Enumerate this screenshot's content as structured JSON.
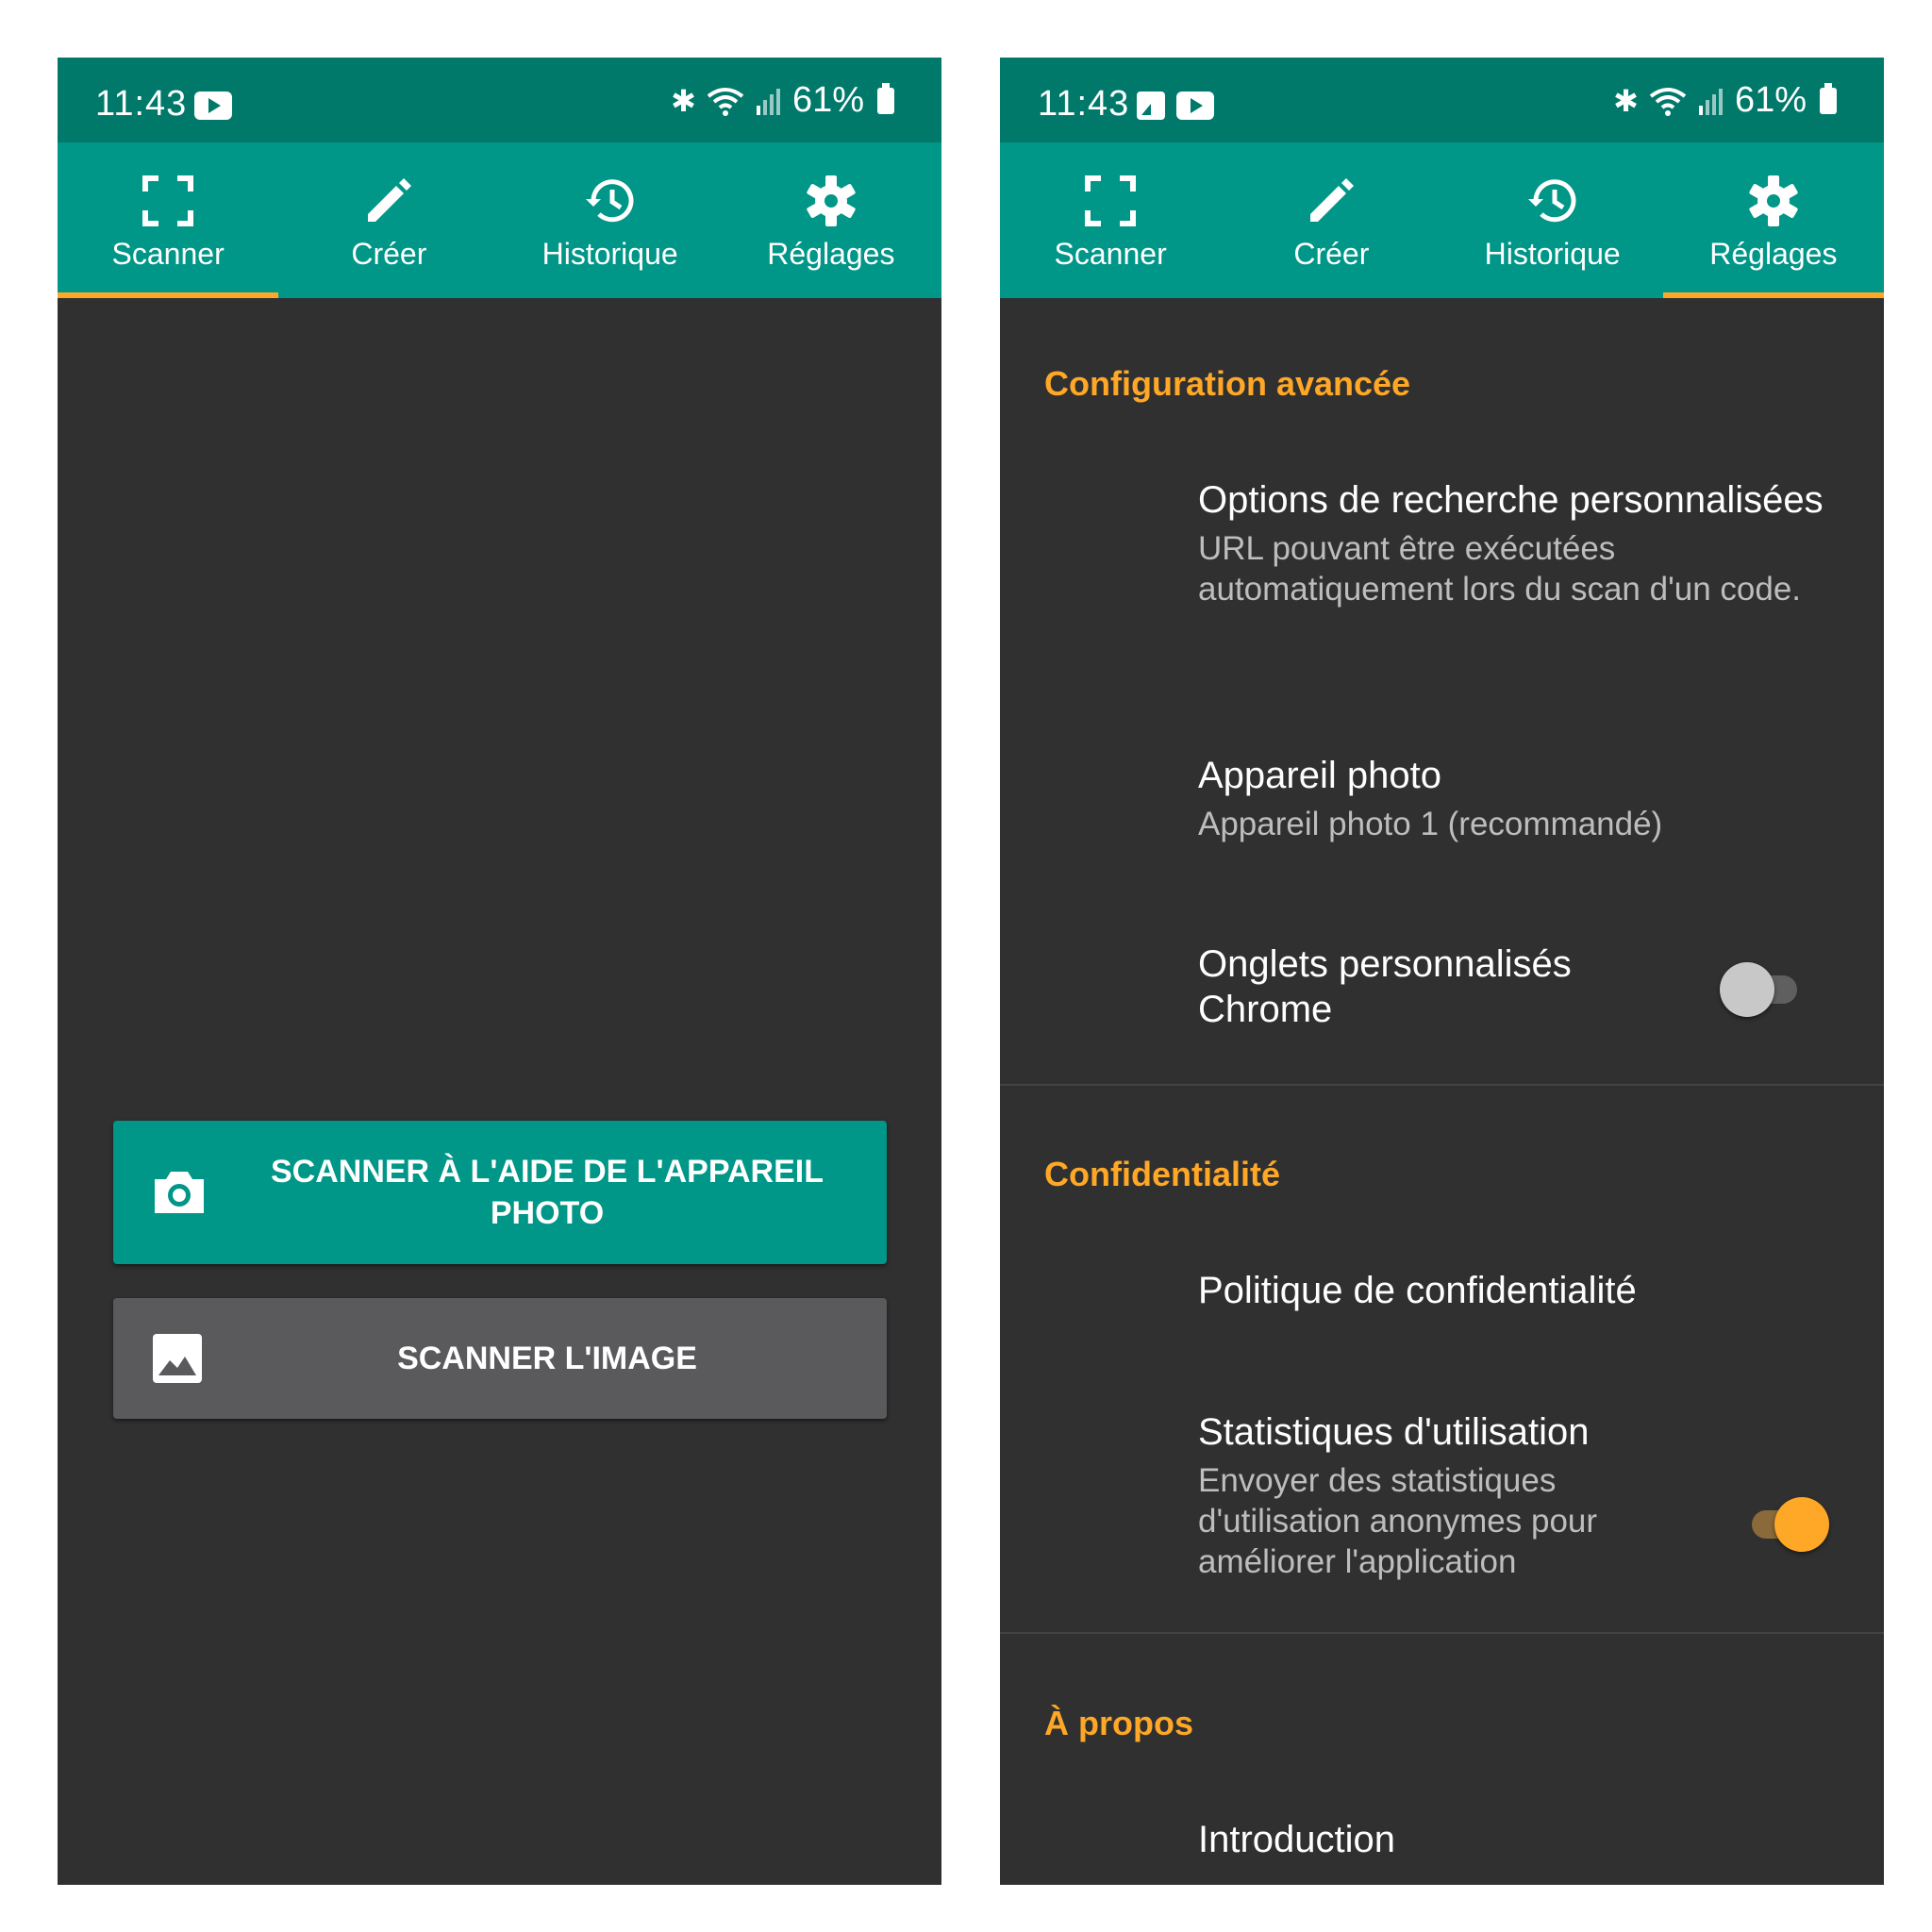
{
  "colors": {
    "statusbar": "#00796b",
    "tabbar": "#009688",
    "accent": "#ffa726",
    "background": "#303030",
    "secondary_button": "#5a5a5c"
  },
  "left": {
    "status": {
      "time": "11:43",
      "battery": "61%"
    },
    "tabs": [
      {
        "label": "Scanner",
        "icon": "scan-frame-icon"
      },
      {
        "label": "Créer",
        "icon": "pencil-icon"
      },
      {
        "label": "Historique",
        "icon": "history-icon"
      },
      {
        "label": "Réglages",
        "icon": "gear-icon"
      }
    ],
    "active_tab": "Scanner",
    "buttons": {
      "camera": "SCANNER À L'AIDE DE L'APPAREIL PHOTO",
      "image": "SCANNER L'IMAGE"
    }
  },
  "right": {
    "status": {
      "time": "11:43",
      "battery": "61%"
    },
    "tabs": [
      {
        "label": "Scanner",
        "icon": "scan-frame-icon"
      },
      {
        "label": "Créer",
        "icon": "pencil-icon"
      },
      {
        "label": "Historique",
        "icon": "history-icon"
      },
      {
        "label": "Réglages",
        "icon": "gear-icon"
      }
    ],
    "active_tab": "Réglages",
    "sections": {
      "advanced": {
        "title": "Configuration avancée",
        "search_options": {
          "title": "Options de recherche personnalisées",
          "summary": "URL pouvant être exécutées automatiquement lors du scan d'un code."
        },
        "camera": {
          "title": "Appareil photo",
          "summary": "Appareil photo 1 (recommandé)"
        },
        "chrome_tabs": {
          "title": "Onglets personnalisés Chrome",
          "enabled": false
        }
      },
      "privacy": {
        "title": "Confidentialité",
        "policy": {
          "title": "Politique de confidentialité"
        },
        "stats": {
          "title": "Statistiques d'utilisation",
          "summary": "Envoyer des statistiques d'utilisation anonymes pour améliorer l'application",
          "enabled": true
        }
      },
      "about": {
        "title": "À propos",
        "intro": {
          "title": "Introduction"
        }
      }
    }
  }
}
